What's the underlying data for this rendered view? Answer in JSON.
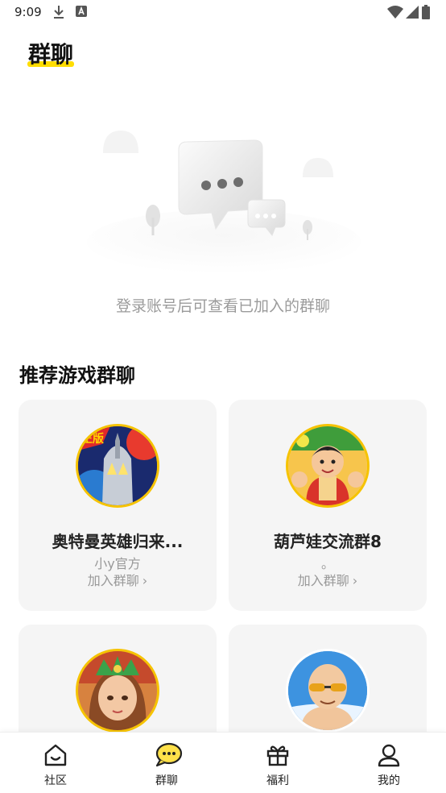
{
  "status_bar": {
    "time": "9:09"
  },
  "header": {
    "title": "群聊"
  },
  "empty_state": {
    "message": "登录账号后可查看已加入的群聊"
  },
  "recommend": {
    "title": "推荐游戏群聊",
    "groups": [
      {
        "name": "奥特曼英雄归来...",
        "desc": "小y官方",
        "join_label": "加入群聊",
        "avatar_icon": "ultraman-avatar"
      },
      {
        "name": "葫芦娃交流群8",
        "desc": "。",
        "join_label": "加入群聊",
        "avatar_icon": "calabash-brother-avatar"
      },
      {
        "name": "",
        "desc": "",
        "join_label": "",
        "avatar_icon": "heroine-avatar"
      },
      {
        "name": "",
        "desc": "",
        "join_label": "",
        "avatar_icon": "bald-man-avatar"
      }
    ]
  },
  "bottom_nav": {
    "items": [
      {
        "label": "社区",
        "icon": "home-icon"
      },
      {
        "label": "群聊",
        "icon": "chat-icon",
        "active": true
      },
      {
        "label": "福利",
        "icon": "gift-icon"
      },
      {
        "label": "我的",
        "icon": "profile-icon"
      }
    ]
  },
  "colors": {
    "accent": "#ffdd00",
    "card_bg": "#f5f5f5",
    "muted_text": "#9b9b9b"
  }
}
